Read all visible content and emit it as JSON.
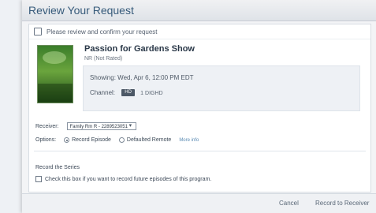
{
  "window": {
    "title": "Review Your Request"
  },
  "notice": {
    "text": "Please review and confirm your request"
  },
  "program": {
    "title": "Passion for Gardens Show",
    "subtitle": "NR (Not Rated)",
    "showing_label": "Showing:",
    "showing_value": "Wed, Apr 6, 12:00 PM EDT",
    "channel_label": "Channel:",
    "channel_badge": "HD",
    "channel_number": "1 DIGHD"
  },
  "receiver": {
    "label": "Receiver:",
    "selected": "Family Rm R - 2289523051"
  },
  "options": {
    "label": "Options:",
    "option_1": "Record Episode",
    "option_2": "Defaulted Remote",
    "link": "More info"
  },
  "series": {
    "title": "Record the Series",
    "checkbox_label": "Check this box if you want to record future episodes of this program."
  },
  "footer": {
    "cancel": "Cancel",
    "record": "Record to Receiver"
  },
  "colors": {
    "title": "#365a7a",
    "link": "#5b8bb3"
  }
}
